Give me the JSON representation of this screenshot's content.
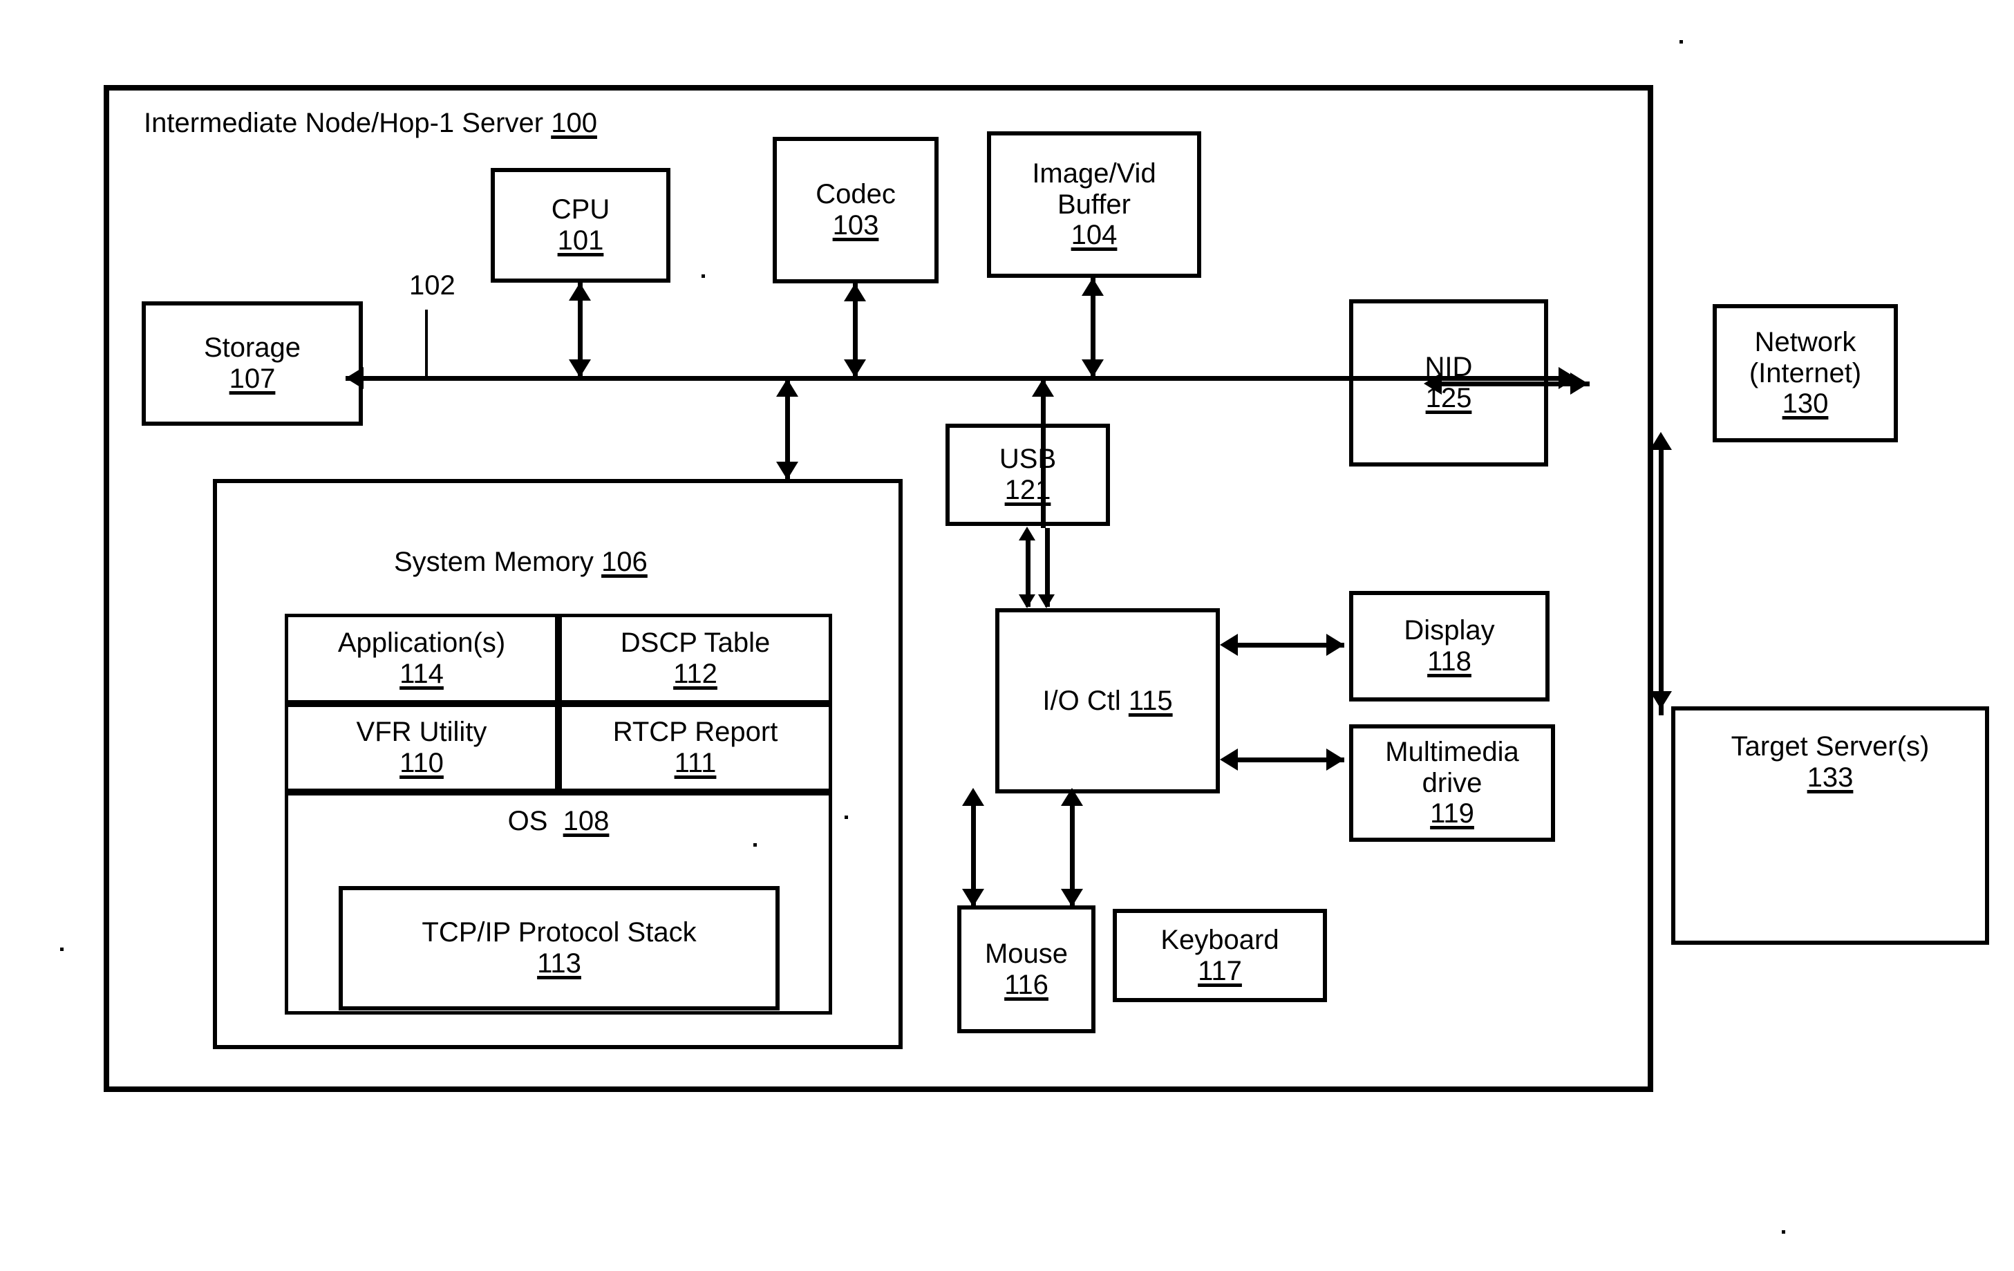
{
  "figure": {
    "outer_container": {
      "title_text": "Intermediate Node/Hop-1 Server",
      "title_num": "100"
    },
    "bus": {
      "label": "102"
    },
    "blocks": [
      {
        "id": "cpu",
        "label": "CPU",
        "num": "101"
      },
      {
        "id": "codec",
        "label": "Codec",
        "num": "103"
      },
      {
        "id": "imgbuf_l1",
        "label": "Image/Vid",
        "label2": "Buffer",
        "num": "104"
      },
      {
        "id": "storage",
        "label": "Storage",
        "num": "107"
      },
      {
        "id": "nid",
        "label": "NID",
        "num": "125"
      },
      {
        "id": "usb",
        "label": "USB",
        "num": "121"
      },
      {
        "id": "ioctl",
        "label": "I/O Ctl",
        "num": "115"
      },
      {
        "id": "display",
        "label": "Display",
        "num": "118"
      },
      {
        "id": "multimedia",
        "label": "Multimedia",
        "label2": "drive",
        "num": "119"
      },
      {
        "id": "mouse",
        "label": "Mouse",
        "num": "116"
      },
      {
        "id": "keyboard",
        "label": "Keyboard",
        "num": "117"
      },
      {
        "id": "network",
        "label": "Network",
        "label2": "(Internet)",
        "num": "130"
      },
      {
        "id": "target",
        "label": "Target Server(s)",
        "num": "133"
      }
    ],
    "system_memory": {
      "title_text": "System Memory",
      "title_num": "106",
      "cells": [
        {
          "id": "applications",
          "label": "Application(s)",
          "num": "114"
        },
        {
          "id": "dscp_table",
          "label": "DSCP Table",
          "num": "112"
        },
        {
          "id": "vfr_utility",
          "label": "VFR Utility",
          "num": "110"
        },
        {
          "id": "rtcp_report",
          "label": "RTCP Report",
          "num": "111"
        }
      ],
      "os": {
        "label": "OS",
        "num": "108",
        "stack": {
          "label": "TCP/IP  Protocol Stack",
          "num": "113"
        }
      }
    },
    "colors": {
      "line": "#000000",
      "background": "#ffffff"
    }
  }
}
